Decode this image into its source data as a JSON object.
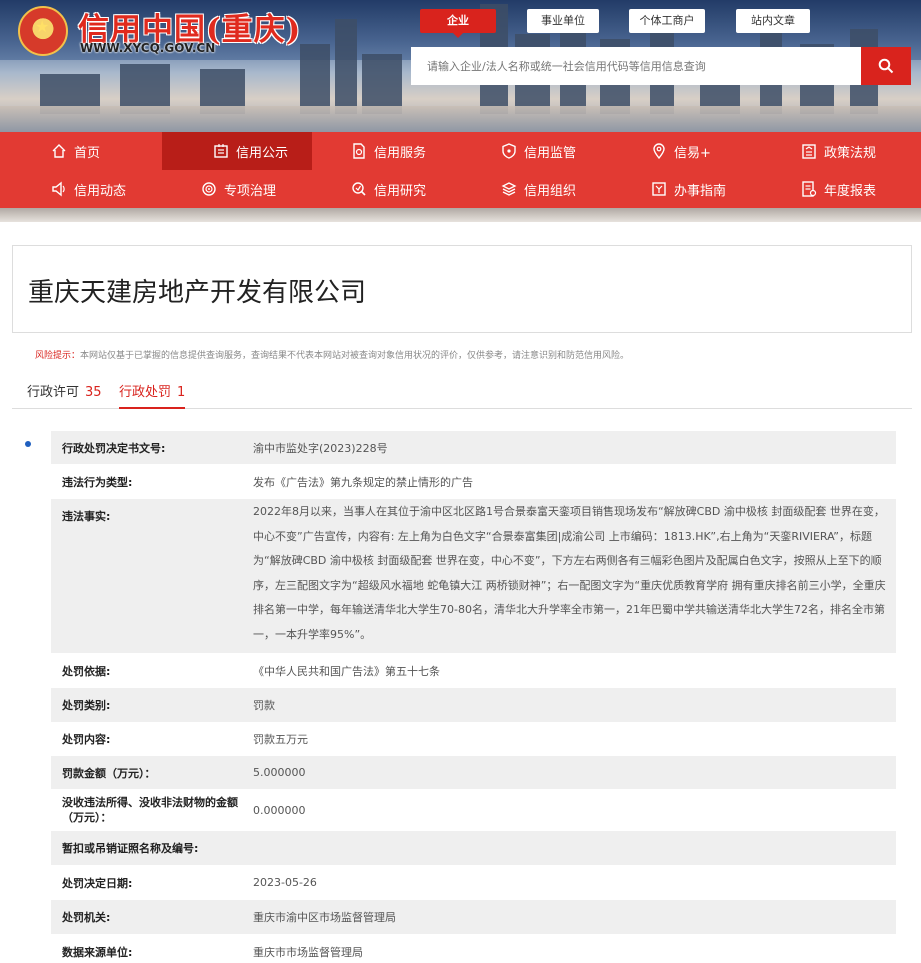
{
  "header": {
    "site_title": "信用中国(重庆)",
    "site_url": "WWW.XYCQ.GOV.CN",
    "search_tabs": [
      {
        "label": "企业",
        "active": true
      },
      {
        "label": "事业单位",
        "active": false
      },
      {
        "label": "个体工商户",
        "active": false
      },
      {
        "label": "站内文章",
        "active": false
      }
    ],
    "search_placeholder": "请输入企业/法人名称或统一社会信用代码等信用信息查询",
    "search_icon": "search-icon"
  },
  "nav": {
    "active": "信用公示",
    "row1": [
      {
        "label": "首页",
        "icon": "home-icon"
      },
      {
        "label": "信用公示",
        "icon": "notice-icon"
      },
      {
        "label": "信用服务",
        "icon": "document-icon"
      },
      {
        "label": "信用监管",
        "icon": "shield-icon"
      },
      {
        "label": "信易+",
        "icon": "location-icon"
      },
      {
        "label": "政策法规",
        "icon": "policy-icon"
      }
    ],
    "row2": [
      {
        "label": "信用动态",
        "icon": "speaker-icon"
      },
      {
        "label": "专项治理",
        "icon": "target-icon"
      },
      {
        "label": "信用研究",
        "icon": "research-icon"
      },
      {
        "label": "信用组织",
        "icon": "layers-icon"
      },
      {
        "label": "办事指南",
        "icon": "guide-icon"
      },
      {
        "label": "年度报表",
        "icon": "report-icon"
      }
    ]
  },
  "company": {
    "name": "重庆天建房地产开发有限公司"
  },
  "risk_notice": {
    "label": "风险提示：",
    "text": "本网站仅基于已掌握的信息提供查询服务，查询结果不代表本网站对被查询对象信用状况的评价，仅供参考，请注意识别和防范信用风险。"
  },
  "tabs": [
    {
      "label": "行政许可",
      "count": "35",
      "active": false
    },
    {
      "label": "行政处罚",
      "count": "1",
      "active": true
    }
  ],
  "penalty": {
    "rows": [
      {
        "key": "行政处罚决定书文号:",
        "value": "渝中市监处字(2023)228号"
      },
      {
        "key": "违法行为类型:",
        "value": "发布《广告法》第九条规定的禁止情形的广告"
      },
      {
        "key": "违法事实:",
        "value": "2022年8月以来，当事人在其位于渝中区北区路1号合景泰富天銮项目销售现场发布“解放碑CBD 渝中极核 封面级配套 世界在变，中心不变”广告宣传，内容有: 左上角为白色文字“合景泰富集团|成渝公司 上市编码：1813.HK”,右上角为“天銮RIVIERA”，标题为“解放碑CBD 渝中极核 封面级配套 世界在变，中心不变”，下方左右两侧各有三幅彩色图片及配属白色文字，按照从上至下的顺序，左三配图文字为“超级风水福地 蛇龟镇大江 两桥锁财神”；右一配图文字为“重庆优质教育学府 拥有重庆排名前三小学，全重庆排名第一中学，每年输送清华北大学生70-80名，清华北大升学率全市第一，21年巴蜀中学共输送清华北大学生72名，排名全市第一，一本升学率95%”。"
      },
      {
        "key": "处罚依据:",
        "value": "《中华人民共和国广告法》第五十七条"
      },
      {
        "key": "处罚类别:",
        "value": "罚款"
      },
      {
        "key": "处罚内容:",
        "value": "罚款五万元"
      },
      {
        "key": "罚款金额（万元）：",
        "value": "5.000000"
      },
      {
        "key": "没收违法所得、没收非法财物的金额（万元）：",
        "value": "0.000000"
      },
      {
        "key": "暂扣或吊销证照名称及编号:",
        "value": ""
      },
      {
        "key": "处罚决定日期:",
        "value": "2023-05-26"
      },
      {
        "key": "处罚机关:",
        "value": "重庆市渝中区市场监督管理局"
      },
      {
        "key": "数据来源单位:",
        "value": "重庆市市场监督管理局"
      }
    ]
  },
  "colors": {
    "brand_red": "#d9231d",
    "nav_red": "#e23a33",
    "nav_active": "#b81e18",
    "row_shade": "#efefef"
  }
}
